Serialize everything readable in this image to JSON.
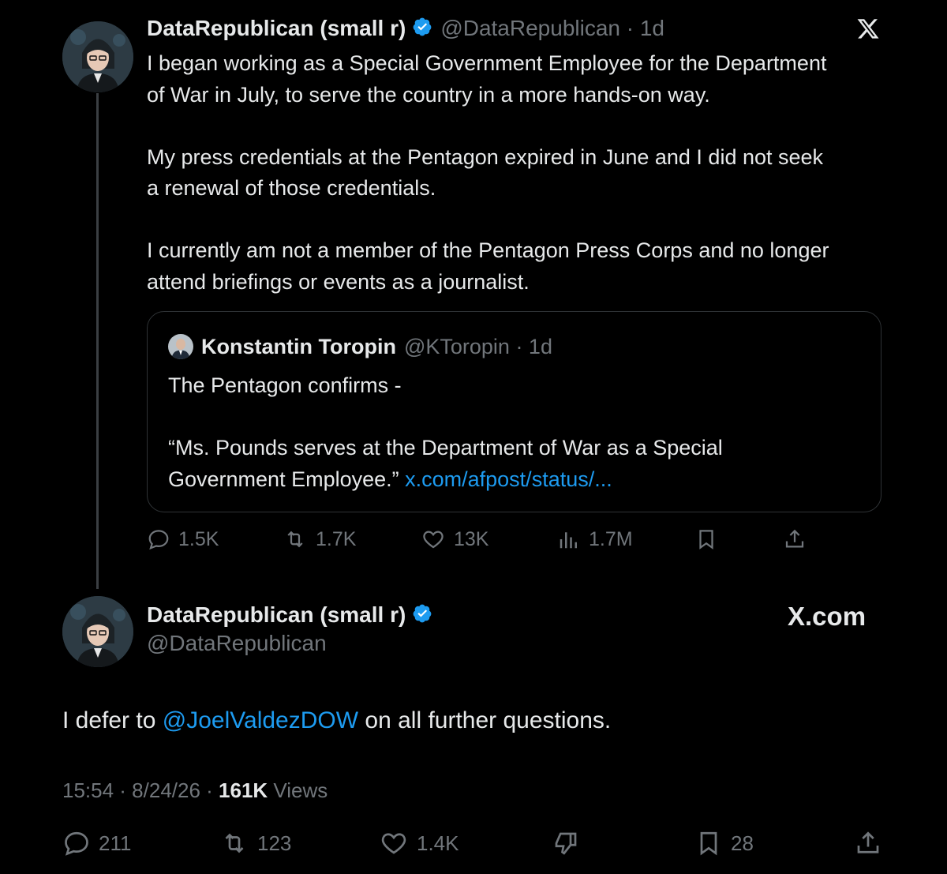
{
  "tweet1": {
    "display_name": "DataRepublican (small r)",
    "handle_time": "@DataRepublican · 1d",
    "body_lines": [
      "I began working as a Special Government Employee for the Department",
      "of War in July, to serve the country in a more hands-on way.",
      "",
      "My press credentials at the Pentagon expired in June and I did not seek",
      "a renewal of those credentials.",
      "",
      "I currently am not a member of the Pentagon Press Corps and no longer",
      "attend briefings or events as a journalist."
    ],
    "quote": {
      "display_name": "Konstantin Toropin",
      "handle_time": "@KToropin · 1d",
      "line1": "The Pentagon confirms -",
      "line2": "“Ms. Pounds serves at the Department of War as a Special",
      "line3_prefix": "Government Employee.” ",
      "link": "x.com/afpost/status/..."
    },
    "actions": {
      "replies": "1.5K",
      "reposts": "1.7K",
      "likes": "13K",
      "views": "1.7M"
    }
  },
  "tweet2": {
    "display_name": "DataRepublican (small r)",
    "handle": "@DataRepublican",
    "watermark": "X.com",
    "body_prefix": "I defer to ",
    "mention": "@JoelValdezDOW",
    "body_suffix": " on all further questions.",
    "time_date": "15:54 · 8/24/26 · ",
    "views_count": "161K",
    "views_label": " Views",
    "actions": {
      "replies": "211",
      "reposts": "123",
      "likes": "1.4K",
      "bookmarks": "28"
    }
  },
  "colors": {
    "background": "#000000",
    "text": "#e7e9ea",
    "muted": "#71767b",
    "link": "#1d9bf0",
    "border": "#2f3336"
  }
}
